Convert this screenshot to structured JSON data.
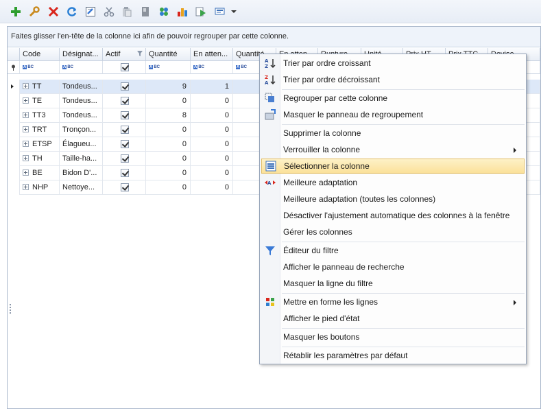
{
  "toolbar": {
    "icons": [
      "add-icon",
      "wrench-icon",
      "delete-icon",
      "refresh-icon",
      "edit-icon",
      "cut-icon",
      "paste-icon",
      "document-icon",
      "grid-icon",
      "chart-icon",
      "run-icon",
      "view-icon",
      "chevron-down-icon"
    ]
  },
  "group_panel": {
    "text": "Faites glisser l'en-tête de la colonne ici afin de pouvoir regrouper par cette colonne."
  },
  "columns": [
    "Code",
    "Désignat...",
    "Actif",
    "Quantité",
    "En atten...",
    "Quantité",
    "En atten",
    "Rupture",
    "Unité",
    "Prix HT",
    "Prix TTC",
    "Devise"
  ],
  "filter_abc": "BC",
  "rows": [
    {
      "code": "TT",
      "designation": "Tondeus...",
      "actif": true,
      "quantite": "9",
      "attente": "1",
      "current": true
    },
    {
      "code": "TE",
      "designation": "Tondeus...",
      "actif": true,
      "quantite": "0",
      "attente": "0"
    },
    {
      "code": "TT3",
      "designation": "Tondeus...",
      "actif": true,
      "quantite": "8",
      "attente": "0"
    },
    {
      "code": "TRT",
      "designation": "Tronçon...",
      "actif": true,
      "quantite": "0",
      "attente": "0"
    },
    {
      "code": "ETSP",
      "designation": "Élagueu...",
      "actif": true,
      "quantite": "0",
      "attente": "0"
    },
    {
      "code": "TH",
      "designation": "Taille-ha...",
      "actif": true,
      "quantite": "0",
      "attente": "0"
    },
    {
      "code": "BE",
      "designation": "Bidon D'...",
      "actif": true,
      "quantite": "0",
      "attente": "0"
    },
    {
      "code": "NHP",
      "designation": "Nettoye...",
      "actif": true,
      "quantite": "0",
      "attente": "0"
    }
  ],
  "menu": {
    "items": [
      {
        "label": "Trier par ordre croissant",
        "icon": "sort-ascending-icon"
      },
      {
        "label": "Trier par ordre décroissant",
        "icon": "sort-descending-icon"
      },
      {
        "label": "Regrouper par cette colonne",
        "icon": "group-by-icon"
      },
      {
        "label": "Masquer le panneau de regroupement",
        "icon": "hide-group-panel-icon"
      },
      {
        "label": "Supprimer la colonne"
      },
      {
        "label": "Verrouiller la colonne",
        "submenu": true
      },
      {
        "label": "Sélectionner la colonne",
        "icon": "select-column-icon",
        "highlighted": true
      },
      {
        "label": "Meilleure adaptation",
        "icon": "best-fit-icon"
      },
      {
        "label": "Meilleure adaptation (toutes les colonnes)"
      },
      {
        "label": "Désactiver l'ajustement automatique des colonnes à la fenêtre"
      },
      {
        "label": "Gérer les colonnes"
      },
      {
        "label": "Éditeur du filtre",
        "icon": "filter-icon"
      },
      {
        "label": "Afficher le panneau de recherche"
      },
      {
        "label": "Masquer la ligne du filtre"
      },
      {
        "label": "Mettre en forme les lignes",
        "icon": "format-rows-icon",
        "submenu": true
      },
      {
        "label": "Afficher le pied d'état"
      },
      {
        "label": "Masquer les boutons"
      },
      {
        "label": "Rétablir les paramètres par défaut"
      }
    ]
  },
  "colors": {
    "accent": "#3d6fc9",
    "selected_row": "#dde8f8",
    "menu_highlight": "#fbe19a"
  }
}
